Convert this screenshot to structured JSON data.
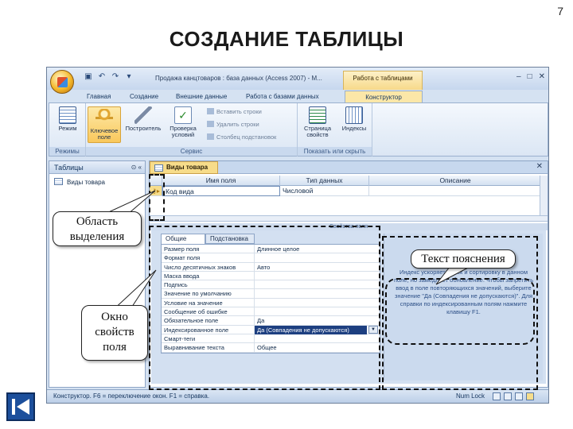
{
  "slide": {
    "number": "7",
    "title": "СОЗДАНИЕ ТАБЛИЦЫ"
  },
  "app": {
    "window_title": "Продажа канцтоваров : база данных (Access 2007) - M...",
    "context_group": "Работа с таблицами",
    "tabs": [
      "Главная",
      "Создание",
      "Внешние данные",
      "Работа с базами данных",
      "Конструктор"
    ],
    "active_tab": "Конструктор"
  },
  "ribbon": {
    "groups": [
      {
        "label": "Режимы",
        "buttons": [
          "Режим"
        ]
      },
      {
        "label": "Сервис",
        "buttons": [
          "Ключевое поле",
          "Построитель",
          "Проверка условий"
        ],
        "small": [
          "Вставить строки",
          "Удалить строки",
          "Столбец подстановок"
        ]
      },
      {
        "label": "Показать или скрыть",
        "buttons": [
          "Страница свойств",
          "Индексы"
        ]
      }
    ]
  },
  "nav": {
    "header": "Таблицы",
    "items": [
      "Виды товара"
    ]
  },
  "design": {
    "doc_tab": "Виды товара",
    "columns": [
      "Имя поля",
      "Тип данных",
      "Описание"
    ],
    "rows": [
      {
        "field": "Код вида",
        "type": "Числовой",
        "desc": ""
      }
    ],
    "props_title": "Свойства поля",
    "prop_tabs": [
      "Общие",
      "Подстановка"
    ],
    "properties": [
      {
        "name": "Размер поля",
        "value": "Длинное целое"
      },
      {
        "name": "Формат поля",
        "value": ""
      },
      {
        "name": "Число десятичных знаков",
        "value": "Авто"
      },
      {
        "name": "Маска ввода",
        "value": ""
      },
      {
        "name": "Подпись",
        "value": ""
      },
      {
        "name": "Значение по умолчанию",
        "value": ""
      },
      {
        "name": "Условие на значение",
        "value": ""
      },
      {
        "name": "Сообщение об ошибке",
        "value": ""
      },
      {
        "name": "Обязательное поле",
        "value": "Да"
      },
      {
        "name": "Индексированное поле",
        "value": "Да (Совпадения не допускаются)"
      },
      {
        "name": "Смарт-теги",
        "value": ""
      },
      {
        "name": "Выравнивание текста",
        "value": "Общее"
      }
    ],
    "help_text": "Индекс ускоряет поиск и сортировку в данном поле, но замедляет обновление. Чтобы запретить ввод в поле повторяющихся значений, выберите значение \"Да (Совпадения не допускаются)\". Для справки по индексированным полям нажмите клавишу F1."
  },
  "status": {
    "text": "Конструктор.  F6 = переключение окон.  F1 = справка.",
    "num_lock": "Num Lock"
  },
  "annotations": {
    "selection_area": "Область выделения",
    "field_props_window": "Окно свойств поля",
    "help_text_label": "Текст пояснения"
  }
}
